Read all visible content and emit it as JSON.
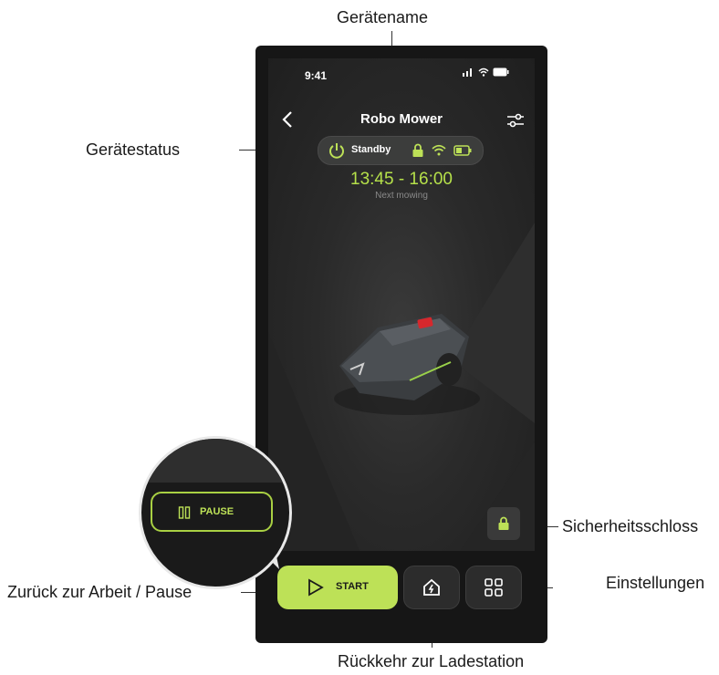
{
  "annotations": {
    "device_name": "Gerätename",
    "device_status": "Gerätestatus",
    "security_lock": "Sicherheitsschloss",
    "back_to_work_pause": "Zurück zur Arbeit / Pause",
    "settings": "Einstellungen",
    "return_to_charger": "Rückkehr zur Ladestation"
  },
  "phone": {
    "status_bar": {
      "time": "9:41"
    },
    "header": {
      "title": "Robo Mower"
    },
    "status_pill": {
      "state": "Standby"
    },
    "schedule": {
      "time_range": "13:45 - 16:00",
      "label": "Next mowing"
    },
    "buttons": {
      "start": "START",
      "pause": "PAUSE"
    }
  },
  "colors": {
    "accent": "#bde157",
    "background": "#161616"
  },
  "icons": [
    "back-chevron-icon",
    "settings-sliders-icon",
    "power-icon",
    "lock-icon",
    "wifi-icon",
    "battery-icon",
    "play-icon",
    "home-icon",
    "grid-icon",
    "pause-icon"
  ]
}
